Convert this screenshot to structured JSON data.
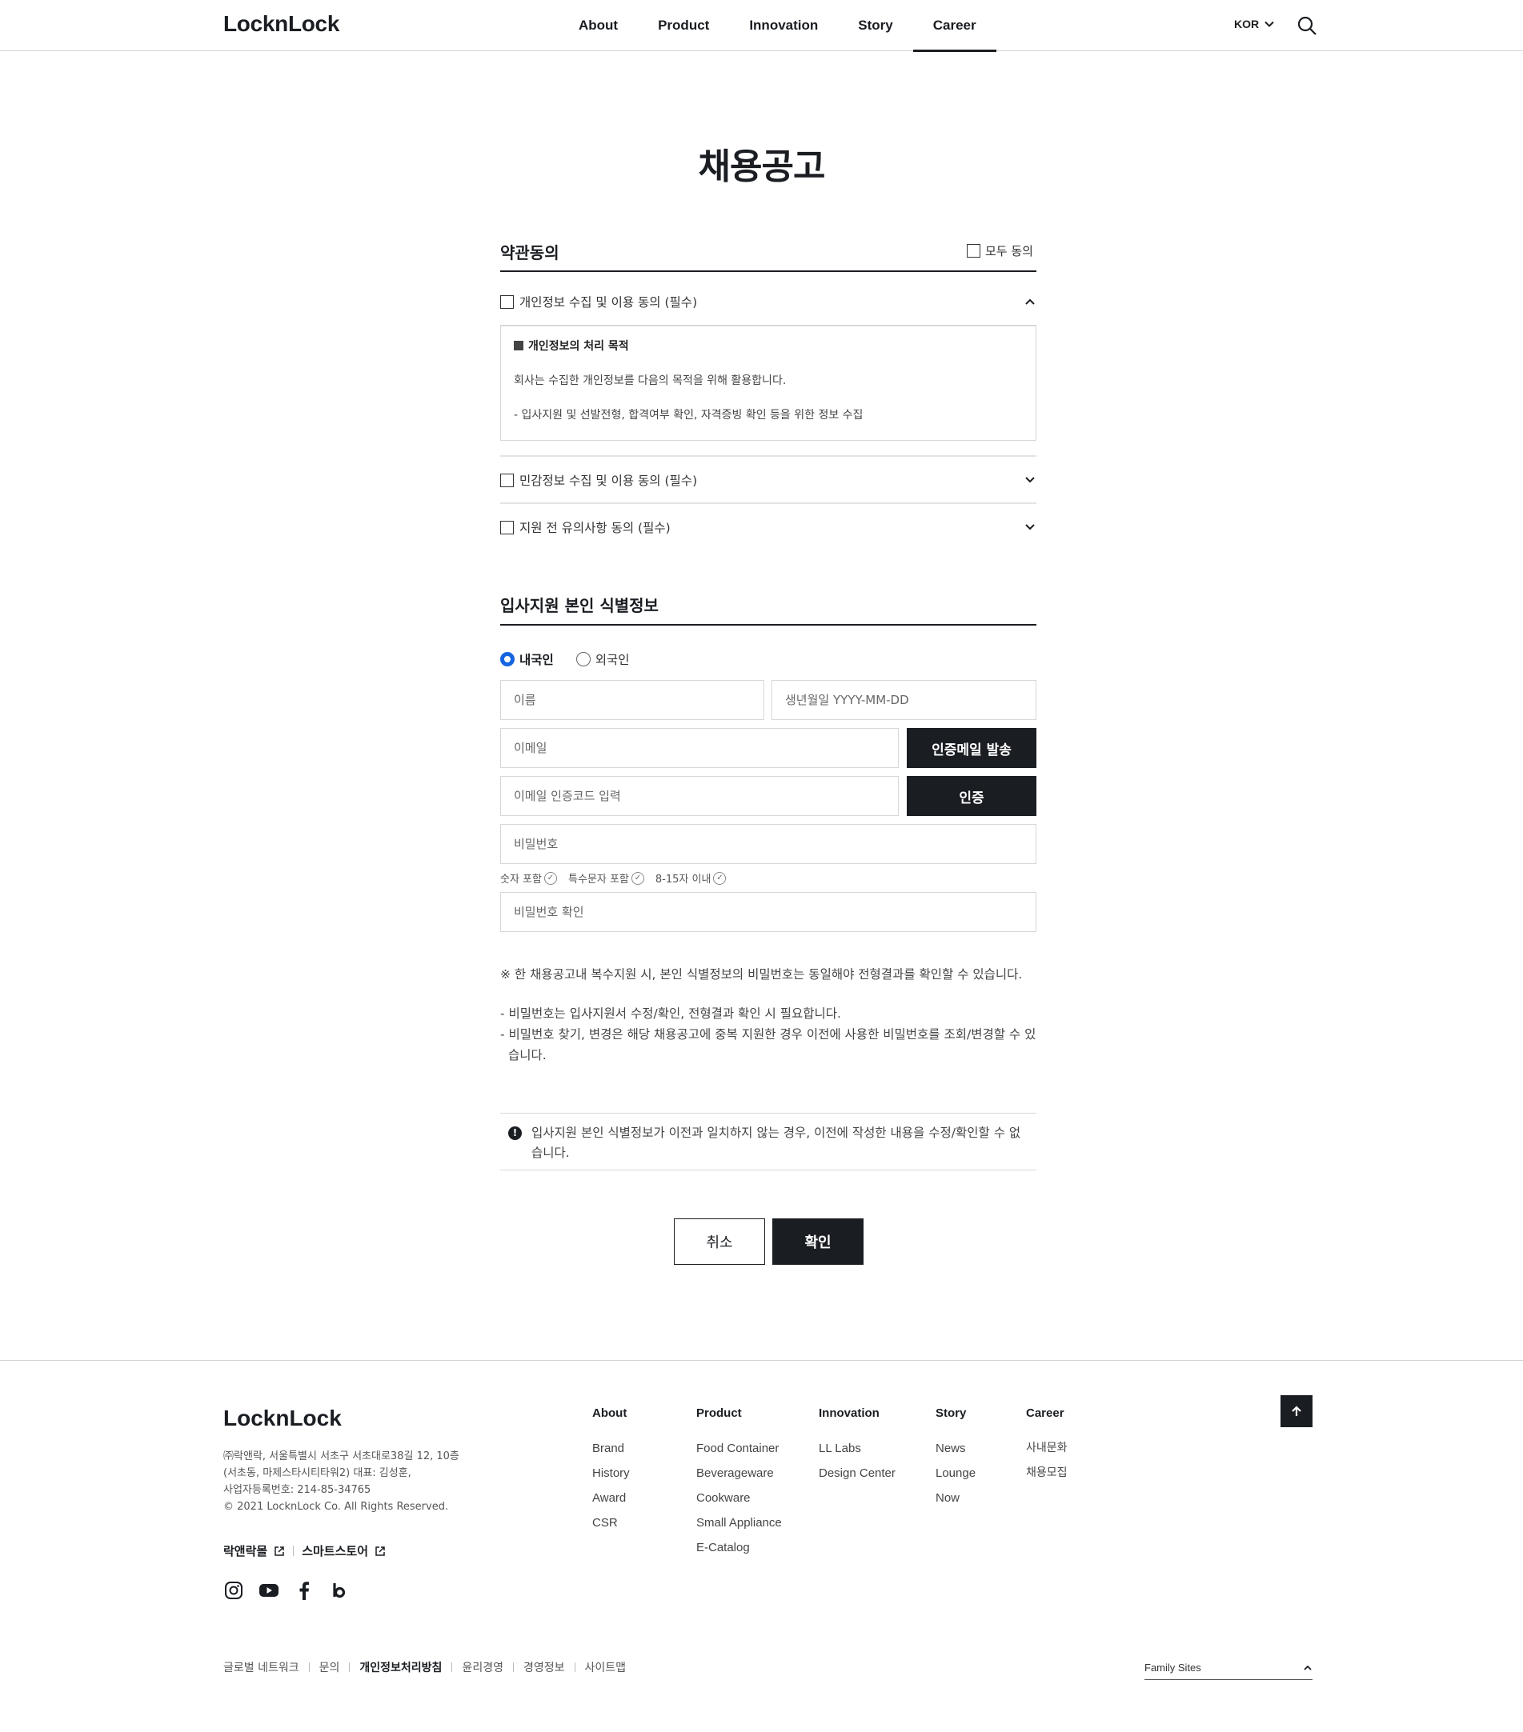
{
  "header": {
    "logo": "LocknLock",
    "nav": [
      "About",
      "Product",
      "Innovation",
      "Story",
      "Career"
    ],
    "active_nav": "Career",
    "lang": "KOR"
  },
  "page": {
    "title": "채용공고"
  },
  "terms": {
    "section_title": "약관동의",
    "all_agree": "모두 동의",
    "items": [
      {
        "label": "개인정보 수집 및 이용 동의 (필수)",
        "expanded": true
      },
      {
        "label": "민감정보 수집 및 이용 동의 (필수)",
        "expanded": false
      },
      {
        "label": "지원 전 유의사항 동의 (필수)",
        "expanded": false
      }
    ],
    "box": {
      "heading": "개인정보의 처리 목적",
      "line1": "회사는 수집한 개인정보를 다음의 목적을 위해 활용합니다.",
      "line2": "- 입사지원 및 선발전형, 합격여부 확인, 자격증빙 확인 등을 위한 정보 수집"
    }
  },
  "identity": {
    "section_title": "입사지원 본인 식별정보",
    "radio_domestic": "내국인",
    "radio_foreign": "외국인",
    "selected": "내국인",
    "name_placeholder": "이름",
    "birth_placeholder": "생년월일 YYYY-MM-DD",
    "email_placeholder": "이메일",
    "send_mail_button": "인증메일 발송",
    "code_placeholder": "이메일 인증코드 입력",
    "verify_button": "인증",
    "password_placeholder": "비밀번호",
    "rules": [
      "숫자 포함",
      "특수문자 포함",
      "8-15자 이내"
    ],
    "password_confirm_placeholder": "비밀번호 확인",
    "notice_main": "※ 한 채용공고내 복수지원 시, 본인 식별정보의 비밀번호는 동일해야 전형결과를 확인할 수 있습니다.",
    "notice_sub1": "- 비밀번호는 입사지원서 수정/확인, 전형결과 확인 시 필요합니다.",
    "notice_sub2": "- 비밀번호 찾기, 변경은 해당 채용공고에 중복 지원한 경우 이전에 사용한 비밀번호를 조회/변경할 수 있습니다.",
    "warning": "입사지원 본인 식별정보가 이전과 일치하지 않는 경우, 이전에 작성한 내용을 수정/확인할 수 없습니다.",
    "cancel_button": "취소",
    "confirm_button": "확인"
  },
  "footer": {
    "logo": "LocknLock",
    "address_line1": "㈜락앤락, 서울특별시 서초구 서초대로38길 12, 10층",
    "address_line2": "(서초동, 마제스타시티타워2) 대표: 김성훈,",
    "address_line3": "사업자등록번호: 214-85-34765",
    "copyright": "© 2021 LocknLock Co. All Rights Reserved.",
    "shop1": "락앤락몰",
    "shop2": "스마트스토어",
    "columns": [
      {
        "head": "About",
        "links": [
          "Brand",
          "History",
          "Award",
          "CSR"
        ]
      },
      {
        "head": "Product",
        "links": [
          "Food Container",
          "Beverageware",
          "Cookware",
          "Small Appliance",
          "E-Catalog"
        ]
      },
      {
        "head": "Innovation",
        "links": [
          "LL Labs",
          "Design Center"
        ]
      },
      {
        "head": "Story",
        "links": [
          "News",
          "Lounge",
          "Now"
        ]
      },
      {
        "head": "Career",
        "links": [
          "사내문화",
          "채용모집"
        ]
      }
    ],
    "bottom_links": [
      "글로벌 네트워크",
      "문의",
      "개인정보처리방침",
      "윤리경영",
      "경영정보",
      "사이트맵"
    ],
    "family_sites": "Family Sites"
  }
}
